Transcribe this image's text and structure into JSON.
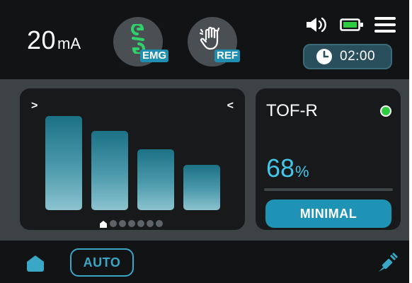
{
  "header": {
    "current_value": "20",
    "current_unit": "mA",
    "emg_label": "EMG",
    "ref_label": "REF",
    "timer": "02:00",
    "icons": [
      "link-icon",
      "hand-icon",
      "volume-icon",
      "battery-icon",
      "menu-icon",
      "clock-icon"
    ]
  },
  "chart": {
    "type": "bar",
    "levels": [
      0.92,
      0.77,
      0.59,
      0.44
    ],
    "page_dots": 7,
    "active_page": 0,
    "nav_left": ">",
    "nav_right": "<"
  },
  "tof": {
    "title": "TOF-R",
    "value": "68",
    "unit": "%",
    "status": "MINIMAL",
    "led_color": "#2ecc40"
  },
  "footer": {
    "auto_label": "AUTO",
    "icons": [
      "home-icon",
      "needle-icon"
    ]
  },
  "colors": {
    "accent": "#1f93b5",
    "accent_text": "#43c6e8",
    "emg_icon": "#2fd26b"
  }
}
